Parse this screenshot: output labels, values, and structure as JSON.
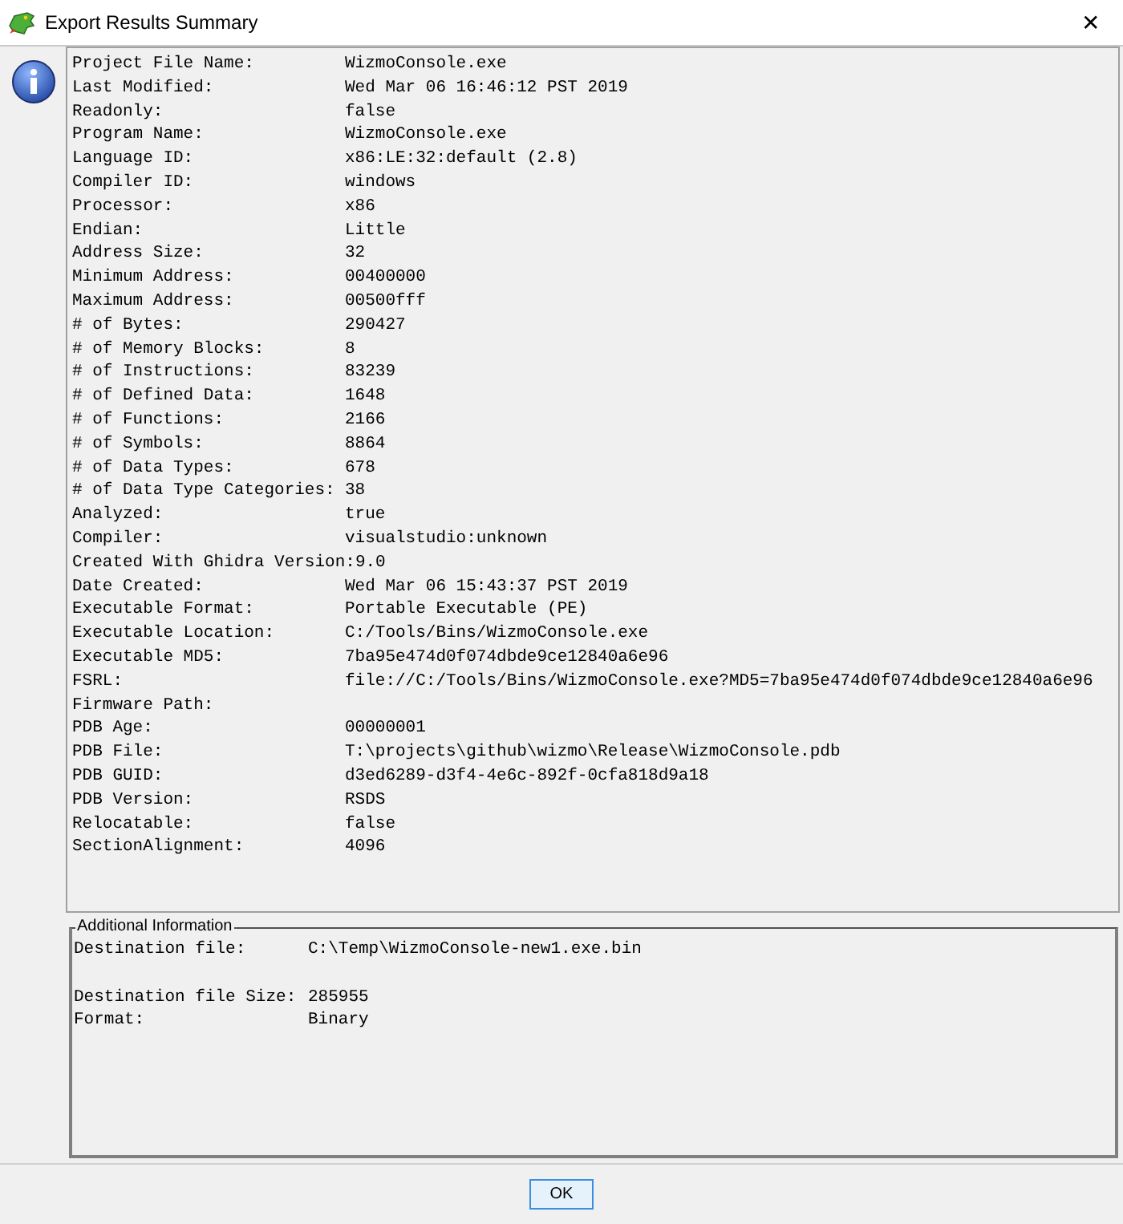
{
  "window": {
    "title": "Export Results Summary",
    "close": "✕"
  },
  "summary": [
    {
      "label": "Project File Name:",
      "value": "WizmoConsole.exe"
    },
    {
      "label": "Last Modified:",
      "value": "Wed Mar 06 16:46:12 PST 2019"
    },
    {
      "label": "Readonly:",
      "value": "false"
    },
    {
      "label": "Program Name:",
      "value": "WizmoConsole.exe"
    },
    {
      "label": "Language ID:",
      "value": "x86:LE:32:default (2.8)"
    },
    {
      "label": "Compiler ID:",
      "value": "windows"
    },
    {
      "label": "Processor:",
      "value": "x86"
    },
    {
      "label": "Endian:",
      "value": "Little"
    },
    {
      "label": "Address Size:",
      "value": "32"
    },
    {
      "label": "Minimum Address:",
      "value": "00400000"
    },
    {
      "label": "Maximum Address:",
      "value": "00500fff"
    },
    {
      "label": "# of Bytes:",
      "value": "290427"
    },
    {
      "label": "# of Memory Blocks:",
      "value": "8"
    },
    {
      "label": "# of Instructions:",
      "value": "83239"
    },
    {
      "label": "# of Defined Data:",
      "value": "1648"
    },
    {
      "label": "# of Functions:",
      "value": "2166"
    },
    {
      "label": "# of Symbols:",
      "value": "8864"
    },
    {
      "label": "# of Data Types:",
      "value": "678"
    },
    {
      "label": "# of Data Type Categories:",
      "value": "38"
    },
    {
      "label": "Analyzed:",
      "value": "true"
    },
    {
      "label": "Compiler:",
      "value": "visualstudio:unknown"
    },
    {
      "label": "Created With Ghidra Version:",
      "value": "9.0"
    },
    {
      "label": "Date Created:",
      "value": "Wed Mar 06 15:43:37 PST 2019"
    },
    {
      "label": "Executable Format:",
      "value": "Portable Executable (PE)"
    },
    {
      "label": "Executable Location:",
      "value": "C:/Tools/Bins/WizmoConsole.exe"
    },
    {
      "label": "Executable MD5:",
      "value": "7ba95e474d0f074dbde9ce12840a6e96"
    },
    {
      "label": "FSRL:",
      "value": "file://C:/Tools/Bins/WizmoConsole.exe?MD5=7ba95e474d0f074dbde9ce12840a6e96"
    },
    {
      "label": "Firmware Path:"
    },
    {
      "label": "PDB Age:",
      "value": "00000001"
    },
    {
      "label": "PDB File:",
      "value": "T:\\projects\\github\\wizmo\\Release\\WizmoConsole.pdb"
    },
    {
      "label": "PDB GUID:",
      "value": "d3ed6289-d3f4-4e6c-892f-0cfa818d9a18"
    },
    {
      "label": "PDB Version:",
      "value": "RSDS"
    },
    {
      "label": "Relocatable:",
      "value": "false"
    },
    {
      "label": "SectionAlignment:",
      "value": "4096"
    }
  ],
  "additional_info": {
    "title": "Additional Information",
    "groups": [
      [
        {
          "label": "Destination file:",
          "value": "C:\\Temp\\WizmoConsole-new1.exe.bin"
        }
      ],
      [
        {
          "label": "Destination file Size:",
          "value": "285955"
        },
        {
          "label": "Format:",
          "value": "Binary"
        }
      ]
    ]
  },
  "buttons": [
    "OK"
  ]
}
